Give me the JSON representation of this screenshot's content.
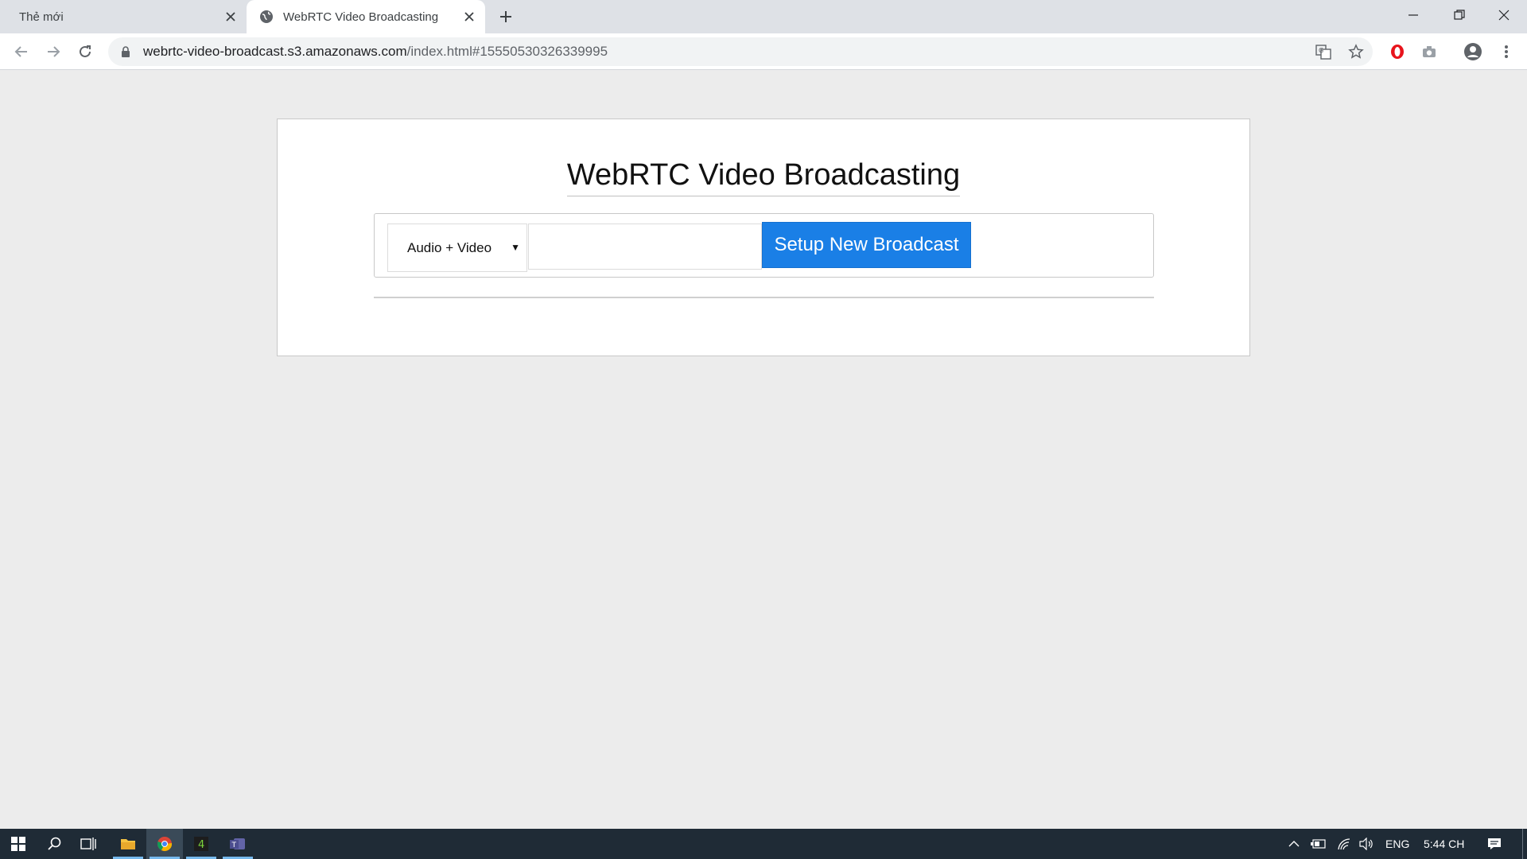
{
  "browser": {
    "tabs": [
      {
        "title": "Thẻ mới",
        "active": false
      },
      {
        "title": "WebRTC Video Broadcasting",
        "active": true
      }
    ],
    "address": {
      "host": "webrtc-video-broadcast.s3.amazonaws.com",
      "path": "/index.html#15550530326339995"
    }
  },
  "page": {
    "title": "WebRTC Video Broadcasting",
    "media_select": {
      "selected": "Audio + Video"
    },
    "room_input": {
      "value": "",
      "placeholder": ""
    },
    "setup_button": {
      "label": "Setup New Broadcast",
      "color": "#1a7fe6"
    }
  },
  "taskbar": {
    "language": "ENG",
    "clock": "5:44 CH",
    "pinned_apps": [
      "windows-start",
      "search",
      "task-view",
      "file-explorer",
      "chrome",
      "app-4",
      "teams"
    ]
  }
}
